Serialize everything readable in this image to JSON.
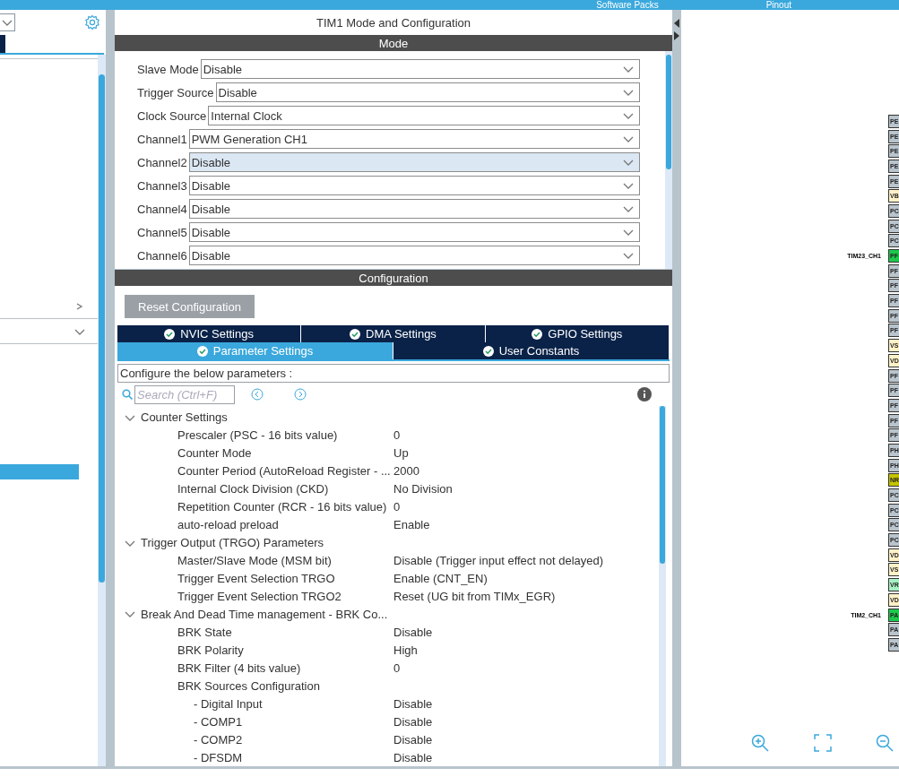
{
  "top_bar": {
    "items": [
      "Software Packs",
      "Pinout"
    ]
  },
  "left_panel": {
    "sections": [
      {
        "expanded": false
      },
      {
        "expanded": true
      }
    ]
  },
  "mode_panel": {
    "title": "TIM1 Mode and Configuration",
    "header": "Mode",
    "fields": [
      {
        "label": "Slave Mode",
        "value": "Disable",
        "selected": false
      },
      {
        "label": "Trigger Source",
        "value": "Disable",
        "selected": false
      },
      {
        "label": "Clock Source",
        "value": "Internal Clock",
        "selected": false
      },
      {
        "label": "Channel1",
        "value": "PWM Generation CH1",
        "selected": false
      },
      {
        "label": "Channel2",
        "value": "Disable",
        "selected": true
      },
      {
        "label": "Channel3",
        "value": "Disable",
        "selected": false
      },
      {
        "label": "Channel4",
        "value": "Disable",
        "selected": false
      },
      {
        "label": "Channel5",
        "value": "Disable",
        "selected": false
      },
      {
        "label": "Channel6",
        "value": "Disable",
        "selected": false
      }
    ]
  },
  "config_panel": {
    "header": "Configuration",
    "reset_button": "Reset Configuration",
    "tab_rows": [
      {
        "tabs": [
          {
            "label": "NVIC Settings",
            "selected": false
          },
          {
            "label": "DMA Settings",
            "selected": false
          },
          {
            "label": "GPIO Settings",
            "selected": false
          }
        ]
      },
      {
        "tabs": [
          {
            "label": "Parameter Settings",
            "selected": true
          },
          {
            "label": "User Constants",
            "selected": false
          }
        ]
      }
    ],
    "description": "Configure the below parameters :",
    "search": {
      "placeholder": "Search (Ctrl+F)"
    },
    "parameters": [
      {
        "label": "Counter Settings",
        "expanded": true,
        "children": [
          {
            "label": "Prescaler (PSC - 16 bits value)",
            "value": "0"
          },
          {
            "label": "Counter Mode",
            "value": "Up"
          },
          {
            "label": "Counter Period (AutoReload Register - ...",
            "value": "2000"
          },
          {
            "label": "Internal Clock Division (CKD)",
            "value": "No Division"
          },
          {
            "label": "Repetition Counter (RCR - 16 bits value)",
            "value": "0"
          },
          {
            "label": "auto-reload preload",
            "value": "Enable"
          }
        ]
      },
      {
        "label": "Trigger Output (TRGO) Parameters",
        "expanded": true,
        "children": [
          {
            "label": "Master/Slave Mode (MSM bit)",
            "value": "Disable (Trigger input effect not delayed)"
          },
          {
            "label": "Trigger Event Selection TRGO",
            "value": "Enable (CNT_EN)"
          },
          {
            "label": "Trigger Event Selection TRGO2",
            "value": "Reset (UG bit from TIMx_EGR)"
          }
        ]
      },
      {
        "label": "Break And Dead Time management - BRK Co...",
        "expanded": true,
        "children": [
          {
            "label": "BRK State",
            "value": "Disable"
          },
          {
            "label": "BRK Polarity",
            "value": "High"
          },
          {
            "label": "BRK Filter (4 bits value)",
            "value": "0"
          },
          {
            "label": "BRK Sources Configuration",
            "children": [
              {
                "label": "- Digital Input",
                "value": "Disable"
              },
              {
                "label": "- COMP1",
                "value": "Disable"
              },
              {
                "label": "- COMP2",
                "value": "Disable"
              },
              {
                "label": "- DFSDM",
                "value": "Disable"
              }
            ]
          }
        ]
      }
    ]
  },
  "pinout": {
    "pins": [
      {
        "label": "PE",
        "color": "#b9c4cc"
      },
      {
        "label": "PE",
        "color": "#b9c4cc"
      },
      {
        "label": "PE",
        "color": "#b9c4cc"
      },
      {
        "label": "PE",
        "color": "#b9c4cc"
      },
      {
        "label": "PE",
        "color": "#b9c4cc"
      },
      {
        "label": "VB",
        "color": "#fff2c8"
      },
      {
        "label": "PC",
        "color": "#b9c4cc"
      },
      {
        "label": "PC",
        "color": "#b9c4cc"
      },
      {
        "label": "PC",
        "color": "#b9c4cc"
      },
      {
        "label": "PF",
        "color": "#1ec84d",
        "signal": "TIM23_CH1"
      },
      {
        "label": "PF",
        "color": "#b9c4cc"
      },
      {
        "label": "PF",
        "color": "#b9c4cc"
      },
      {
        "label": "PF",
        "color": "#b9c4cc"
      },
      {
        "label": "PF",
        "color": "#b9c4cc"
      },
      {
        "label": "PF",
        "color": "#b9c4cc"
      },
      {
        "label": "VS",
        "color": "#fff2c8"
      },
      {
        "label": "VD",
        "color": "#fff2c8"
      },
      {
        "label": "PF",
        "color": "#b9c4cc"
      },
      {
        "label": "PF",
        "color": "#b9c4cc"
      },
      {
        "label": "PF",
        "color": "#b9c4cc"
      },
      {
        "label": "PF",
        "color": "#b9c4cc"
      },
      {
        "label": "PF",
        "color": "#b9c4cc"
      },
      {
        "label": "PH",
        "color": "#b9c4cc"
      },
      {
        "label": "PH",
        "color": "#b9c4cc"
      },
      {
        "label": "NR",
        "color": "#c4c400"
      },
      {
        "label": "PC",
        "color": "#b9c4cc"
      },
      {
        "label": "PC",
        "color": "#b9c4cc"
      },
      {
        "label": "PC",
        "color": "#b9c4cc"
      },
      {
        "label": "PC",
        "color": "#b9c4cc"
      },
      {
        "label": "VD",
        "color": "#fff2c8"
      },
      {
        "label": "VS",
        "color": "#fff2c8"
      },
      {
        "label": "VR",
        "color": "#a8f0c4"
      },
      {
        "label": "VD",
        "color": "#fff2c8"
      },
      {
        "label": "PA",
        "color": "#1ec84d",
        "signal": "TIM2_CH1"
      },
      {
        "label": "PA",
        "color": "#b9c4cc"
      },
      {
        "label": "PA",
        "color": "#b9c4cc"
      }
    ]
  }
}
